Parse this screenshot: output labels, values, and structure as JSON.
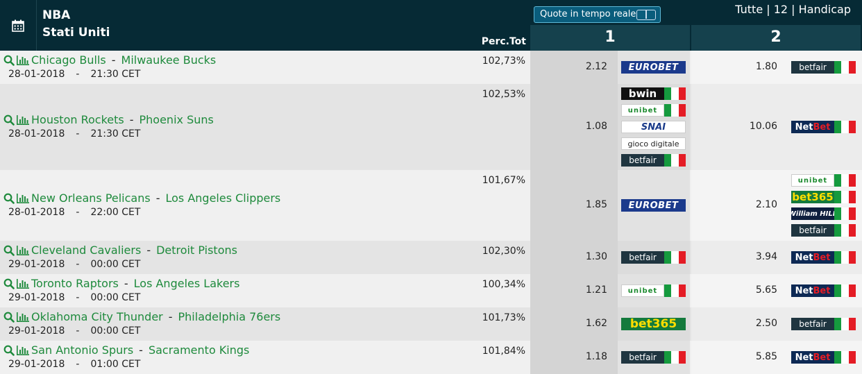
{
  "header": {
    "league": "NBA",
    "country": "Stati Uniti",
    "perc_label": "Perc.Tot",
    "realtime_label": "Quote in tempo reale",
    "filters": "Tutte | 12 | Handicap",
    "col1": "1",
    "col2": "2"
  },
  "matches": [
    {
      "home": "Chicago Bulls",
      "away": "Milwaukee Bucks",
      "date": "28-01-2018",
      "time": "21:30 CET",
      "perc": "102,73%",
      "odd1": "2.12",
      "odd2": "1.80",
      "bk1": [
        "EUROBET"
      ],
      "bk2": [
        "betfair"
      ]
    },
    {
      "home": "Houston Rockets",
      "away": "Phoenix Suns",
      "date": "28-01-2018",
      "time": "21:30 CET",
      "perc": "102,53%",
      "odd1": "1.08",
      "odd2": "10.06",
      "bk1": [
        "bwin",
        "unibet",
        "SNAI",
        "gioco digitale",
        "betfair"
      ],
      "bk2": [
        "NetBet"
      ]
    },
    {
      "home": "New Orleans Pelicans",
      "away": "Los Angeles Clippers",
      "date": "28-01-2018",
      "time": "22:00 CET",
      "perc": "101,67%",
      "odd1": "1.85",
      "odd2": "2.10",
      "bk1": [
        "EUROBET"
      ],
      "bk2": [
        "unibet",
        "bet365",
        "William HILL",
        "betfair"
      ]
    },
    {
      "home": "Cleveland Cavaliers",
      "away": "Detroit Pistons",
      "date": "29-01-2018",
      "time": "00:00 CET",
      "perc": "102,30%",
      "odd1": "1.30",
      "odd2": "3.94",
      "bk1": [
        "betfair"
      ],
      "bk2": [
        "NetBet"
      ]
    },
    {
      "home": "Toronto Raptors",
      "away": "Los Angeles Lakers",
      "date": "29-01-2018",
      "time": "00:00 CET",
      "perc": "100,34%",
      "odd1": "1.21",
      "odd2": "5.65",
      "bk1": [
        "unibet"
      ],
      "bk2": [
        "NetBet"
      ]
    },
    {
      "home": "Oklahoma City Thunder",
      "away": "Philadelphia 76ers",
      "date": "29-01-2018",
      "time": "00:00 CET",
      "perc": "101,73%",
      "odd1": "1.62",
      "odd2": "2.50",
      "bk1": [
        "bet365"
      ],
      "bk2": [
        "betfair"
      ]
    },
    {
      "home": "San Antonio Spurs",
      "away": "Sacramento Kings",
      "date": "29-01-2018",
      "time": "01:00 CET",
      "perc": "101,84%",
      "odd1": "1.18",
      "odd2": "5.85",
      "bk1": [
        "betfair"
      ],
      "bk2": [
        "NetBet"
      ]
    }
  ],
  "colors": {
    "header_bg": "#062a35",
    "column_header_bg": "#15414d",
    "team_link": "#1e8a3c"
  }
}
